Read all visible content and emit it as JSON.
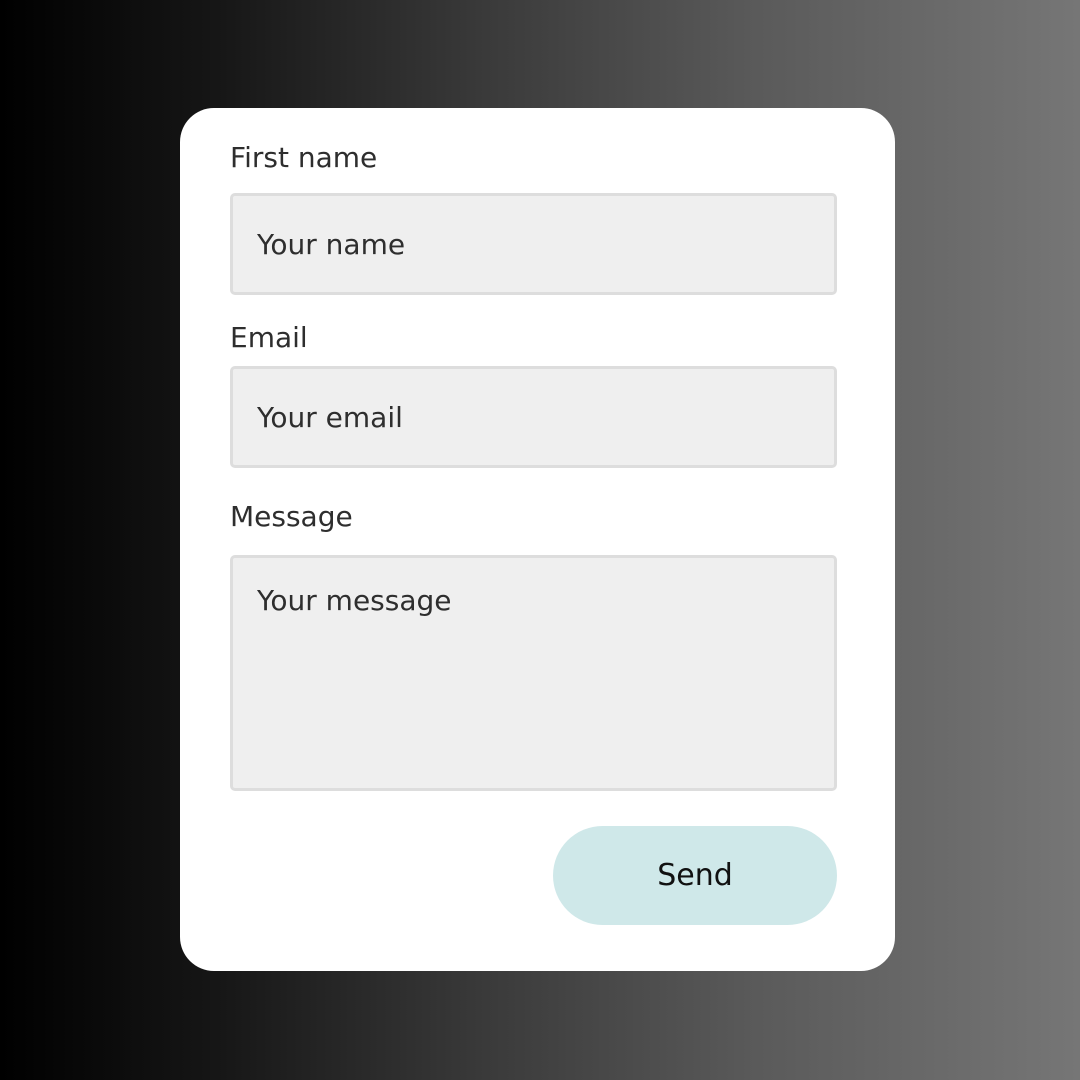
{
  "form": {
    "first_name": {
      "label": "First name",
      "value": "",
      "placeholder": "Your name"
    },
    "email": {
      "label": "Email",
      "value": "",
      "placeholder": "Your email"
    },
    "message": {
      "label": "Message",
      "value": "",
      "placeholder": "Your message"
    },
    "send_label": "Send"
  },
  "colors": {
    "card_background": "#ffffff",
    "field_background": "#efefef",
    "field_border": "#dddddd",
    "button_background": "#cfe8e9",
    "text": "#2e2e2e"
  }
}
